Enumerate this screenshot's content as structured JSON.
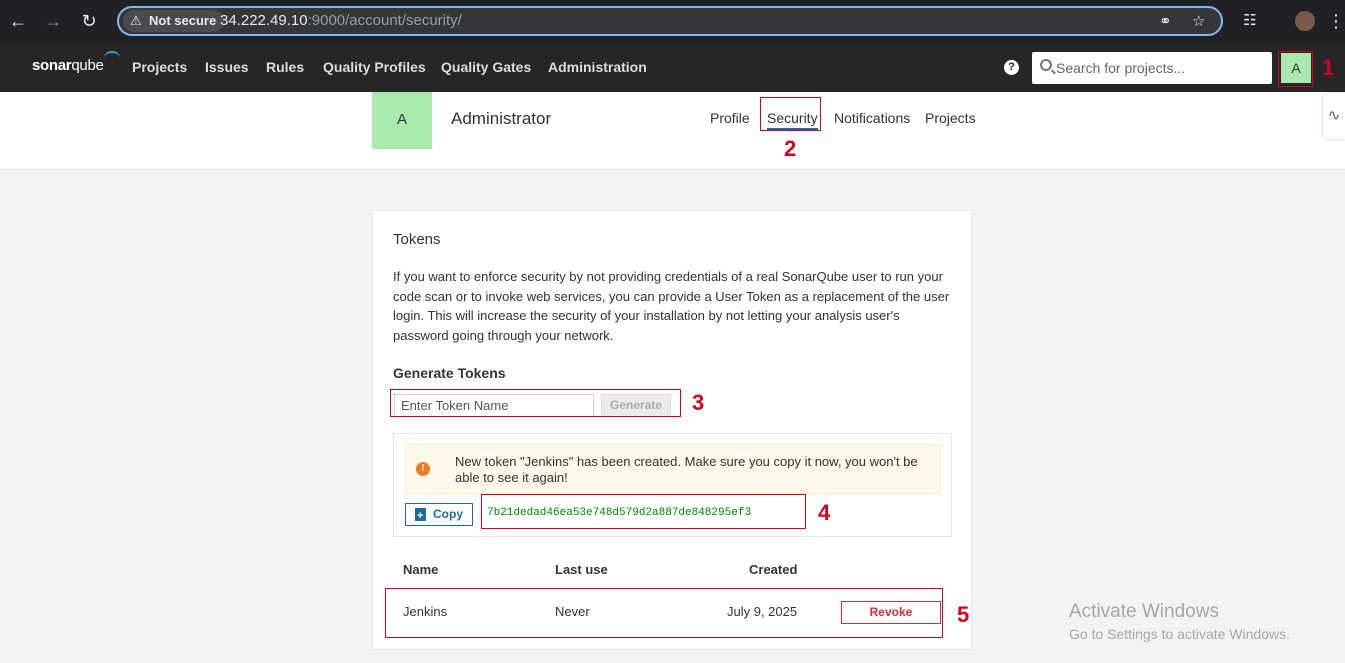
{
  "browser": {
    "security_label": "Not secure",
    "url_host": "34.222.49.10",
    "url_rest": ":9000/account/security/"
  },
  "navbar": {
    "logo_main": "sonar",
    "logo_qube": "qube",
    "links": [
      "Projects",
      "Issues",
      "Rules",
      "Quality Profiles",
      "Quality Gates",
      "Administration"
    ],
    "help_label": "?",
    "search_placeholder": "Search for projects...",
    "user_initial": "A"
  },
  "account": {
    "avatar_initial": "A",
    "name": "Administrator",
    "tabs": [
      "Profile",
      "Security",
      "Notifications",
      "Projects"
    ],
    "active_tab": "Security"
  },
  "tokens": {
    "title": "Tokens",
    "description": "If you want to enforce security by not providing credentials of a real SonarQube user to run your code scan or to invoke web services, you can provide a User Token as a replacement of the user login. This will increase the security of your installation by not letting your analysis user's password going through your network.",
    "generate_title": "Generate Tokens",
    "input_placeholder": "Enter Token Name",
    "generate_label": "Generate",
    "new_token_message": "New token \"Jenkins\" has been created. Make sure you copy it now, you won't be able to see it again!",
    "copy_label": "Copy",
    "token_value": "7b21dedad46ea53e748d579d2a887de848295ef3",
    "columns": [
      "Name",
      "Last use",
      "Created"
    ],
    "rows": [
      {
        "name": "Jenkins",
        "last_use": "Never",
        "created": "July 9, 2025",
        "action": "Revoke"
      }
    ]
  },
  "annotations": [
    "1",
    "2",
    "3",
    "4",
    "5"
  ],
  "watermark": {
    "line1": "Activate Windows",
    "line2": "Go to Settings to activate Windows."
  },
  "colors": {
    "annotation": "#d0021b",
    "avatar": "#aaeaae",
    "sonar_blue": "#236a97",
    "revoke": "#d02f3a",
    "token_green": "#008a00"
  }
}
